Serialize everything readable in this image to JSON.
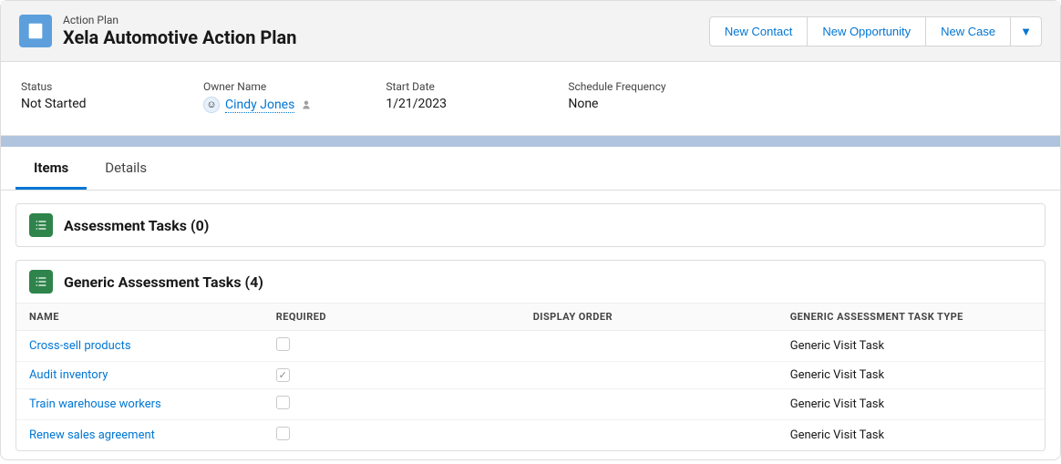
{
  "header": {
    "object_label": "Action Plan",
    "title": "Xela Automotive Action Plan",
    "actions": {
      "new_contact": "New Contact",
      "new_opportunity": "New Opportunity",
      "new_case": "New Case"
    }
  },
  "fields": {
    "status": {
      "label": "Status",
      "value": "Not Started"
    },
    "owner": {
      "label": "Owner Name",
      "value": "Cindy Jones"
    },
    "start_date": {
      "label": "Start Date",
      "value": "1/21/2023"
    },
    "schedule": {
      "label": "Schedule Frequency",
      "value": "None"
    }
  },
  "tabs": {
    "items": "Items",
    "details": "Details"
  },
  "sections": {
    "assessment": {
      "title": "Assessment Tasks (0)"
    },
    "generic": {
      "title": "Generic Assessment Tasks (4)",
      "columns": {
        "name": "Name",
        "required": "Required",
        "display_order": "Display Order",
        "type": "Generic Assessment Task Type"
      },
      "rows": [
        {
          "name": "Cross-sell products",
          "required": false,
          "type": "Generic Visit Task"
        },
        {
          "name": "Audit inventory",
          "required": true,
          "type": "Generic Visit Task"
        },
        {
          "name": "Train warehouse workers",
          "required": false,
          "type": "Generic Visit Task"
        },
        {
          "name": "Renew sales agreement",
          "required": false,
          "type": "Generic Visit Task"
        }
      ]
    }
  },
  "icons": {
    "caret_down": "▼"
  }
}
